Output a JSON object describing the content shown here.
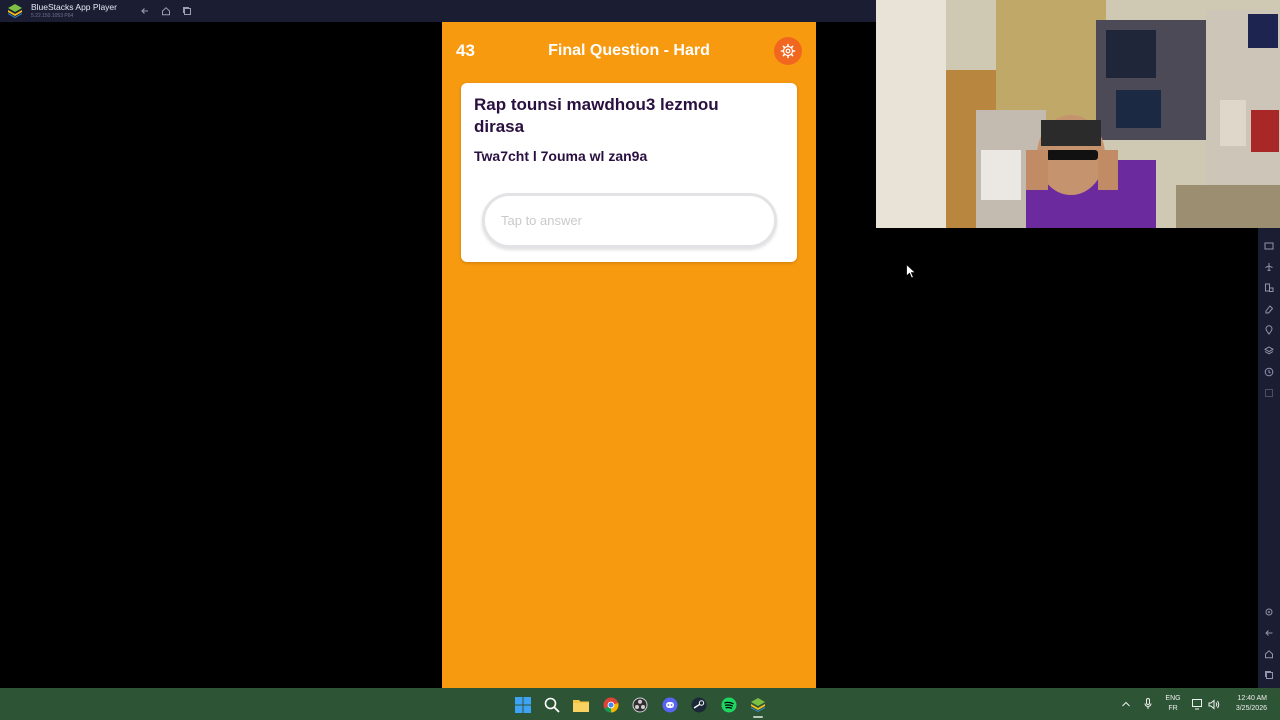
{
  "window": {
    "title": "BlueStacks App Player",
    "version": "5.22.150.1053 P64",
    "icons": [
      "back-icon",
      "home-icon",
      "multi-instance-icon"
    ]
  },
  "game": {
    "score": "43",
    "question_title": "Final Question - Hard",
    "question": "Rap tounsi mawdhou3 lezmou dirasa",
    "hint": "Twa7cht l 7ouma wl zan9a",
    "answer_placeholder": "Tap to answer",
    "settings_icon": "gear-icon",
    "colors": {
      "background": "#f79a0f",
      "settings_button": "#f2671f",
      "text": "#2a1040"
    }
  },
  "sidebar": {
    "icons": [
      "screenshot-icon",
      "airplane-icon",
      "rotate-icon",
      "eraser-icon",
      "location-icon",
      "layers-icon",
      "macro-icon",
      "more-icon",
      "settings-icon",
      "back-icon",
      "home-icon",
      "recents-icon"
    ]
  },
  "taskbar": {
    "apps": [
      "windows-start-icon",
      "search-icon",
      "file-explorer-icon",
      "chrome-icon",
      "obs-icon",
      "discord-icon",
      "steam-icon",
      "spotify-icon",
      "bluestacks-icon"
    ],
    "lang_top": "ENG",
    "lang_bottom": "FR",
    "time": "12:40 AM",
    "date": "3/25/2026"
  }
}
